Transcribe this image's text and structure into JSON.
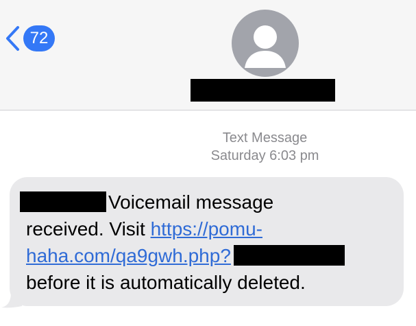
{
  "header": {
    "back_badge_count": "72",
    "colors": {
      "accent": "#3478f6",
      "header_bg": "#f6f6f6",
      "avatar_bg": "#a2a4ab"
    },
    "icons": {
      "back": "chevron-left-icon",
      "avatar": "person-icon"
    }
  },
  "thread": {
    "timestamp_label": "Text Message",
    "timestamp_value": "Saturday 6:03 pm"
  },
  "message": {
    "line1_text": "Voicemail message",
    "line2_text": "received. Visit ",
    "link_part1": "https://pomu-",
    "link_part2": "haha.com/qa9gwh.php?",
    "line4_text": "before it is automatically deleted.",
    "bubble_color": "#e9e9eb",
    "link_color": "#2f6bd6"
  }
}
